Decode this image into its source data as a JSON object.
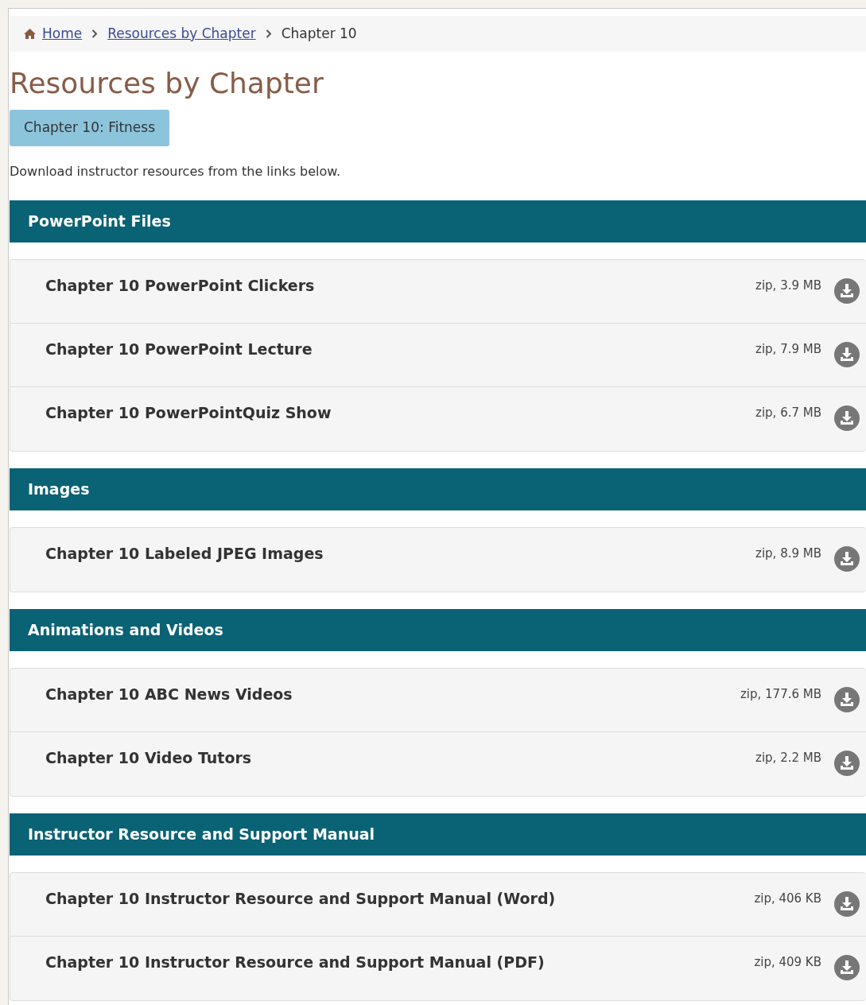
{
  "breadcrumb": [
    {
      "label": "Home",
      "kind": "link"
    },
    {
      "label": "Resources by Chapter",
      "kind": "link"
    },
    {
      "label": "Chapter 10",
      "kind": "current"
    }
  ],
  "title": "Resources by Chapter",
  "chapter_tab": "Chapter 10: Fitness",
  "intro": "Download instructor resources from the links below.",
  "sections": [
    {
      "heading": "PowerPoint Files",
      "items": [
        {
          "name": "Chapter 10 PowerPoint Clickers",
          "size": "zip, 3.9 MB"
        },
        {
          "name": "Chapter 10 PowerPoint Lecture",
          "size": "zip, 7.9 MB"
        },
        {
          "name": "Chapter 10 PowerPointQuiz Show",
          "size": "zip, 6.7 MB"
        }
      ]
    },
    {
      "heading": "Images",
      "items": [
        {
          "name": "Chapter 10 Labeled JPEG Images",
          "size": "zip, 8.9 MB"
        }
      ]
    },
    {
      "heading": "Animations and Videos",
      "items": [
        {
          "name": "Chapter 10 ABC News Videos",
          "size": "zip, 177.6 MB"
        },
        {
          "name": "Chapter 10 Video Tutors",
          "size": "zip, 2.2 MB"
        }
      ]
    },
    {
      "heading": "Instructor Resource and Support Manual",
      "items": [
        {
          "name": "Chapter 10 Instructor Resource and Support Manual (Word)",
          "size": "zip, 406 KB"
        },
        {
          "name": "Chapter 10 Instructor Resource and Support Manual (PDF)",
          "size": "zip, 409 KB"
        }
      ]
    }
  ]
}
